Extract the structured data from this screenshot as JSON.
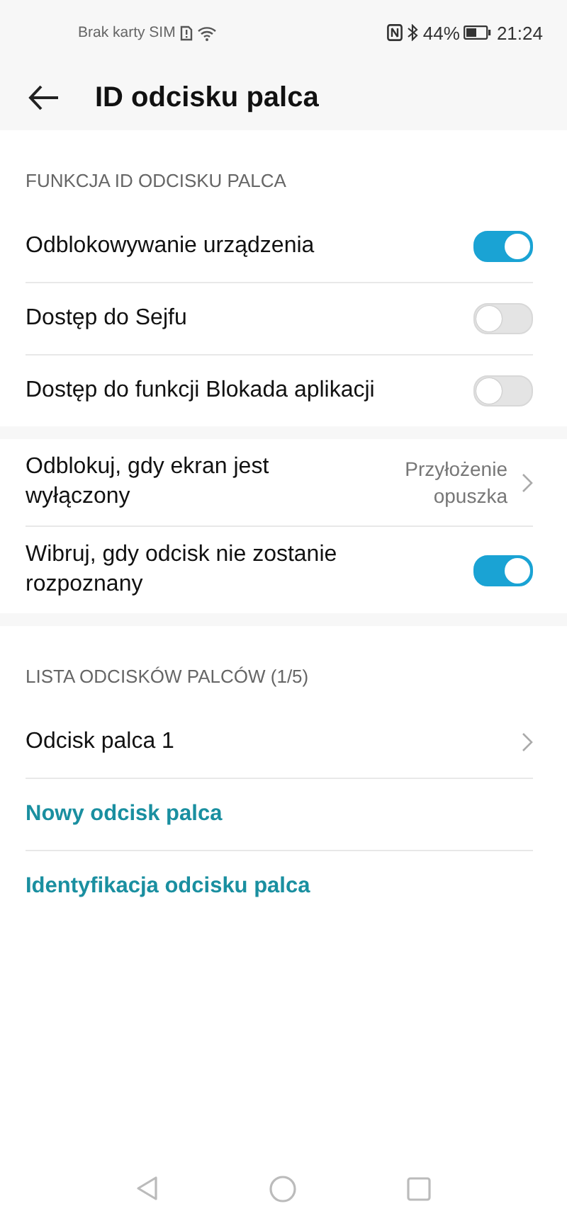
{
  "status_bar": {
    "carrier": "Brak karty SIM",
    "battery": "44%",
    "time": "21:24"
  },
  "header": {
    "title": "ID odcisku palca"
  },
  "sections": [
    {
      "title": "FUNKCJA ID ODCISKU PALCA",
      "items": [
        {
          "kind": "toggle",
          "label": "Odblokowywanie urządzenia",
          "on": true
        },
        {
          "kind": "toggle",
          "label": "Dostęp do Sejfu",
          "on": false
        },
        {
          "kind": "toggle",
          "label": "Dostęp do funkcji Blokada aplikacji",
          "on": false
        }
      ]
    },
    {
      "items": [
        {
          "kind": "value",
          "label": "Odblokuj, gdy ekran jest wyłączony",
          "value": "Przyłożenie opuszka"
        },
        {
          "kind": "toggle",
          "label": "Wibruj, gdy odcisk nie zostanie rozpoznany",
          "on": true
        }
      ]
    },
    {
      "title": "LISTA ODCISKÓW PALCÓW (1/5)",
      "items": [
        {
          "kind": "chevron",
          "label": "Odcisk palca 1"
        },
        {
          "kind": "link",
          "label": "Nowy odcisk palca"
        },
        {
          "kind": "link",
          "label": "Identyfikacja odcisku palca"
        }
      ]
    }
  ]
}
